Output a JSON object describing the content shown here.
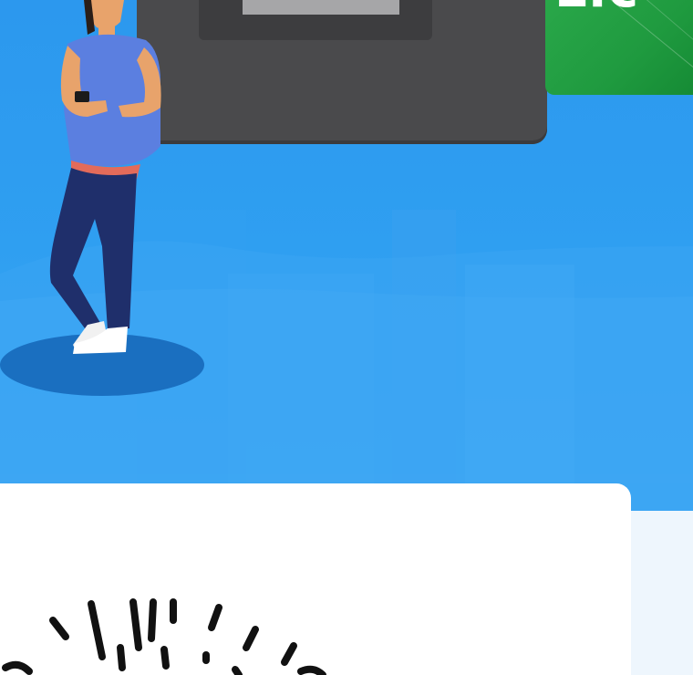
{
  "banner": {
    "text": "Lic",
    "color": "#1f9a3f"
  },
  "colors": {
    "background": "#2f9bef",
    "machine": "#4a4a4c",
    "card": "#ffffff",
    "shadow": "#1a6fc0",
    "shirt": "#5b7fe0",
    "pants": "#1f2f6b"
  },
  "icons": [
    "atm-machine",
    "person-with-phone",
    "sparkle-burst-icon"
  ]
}
